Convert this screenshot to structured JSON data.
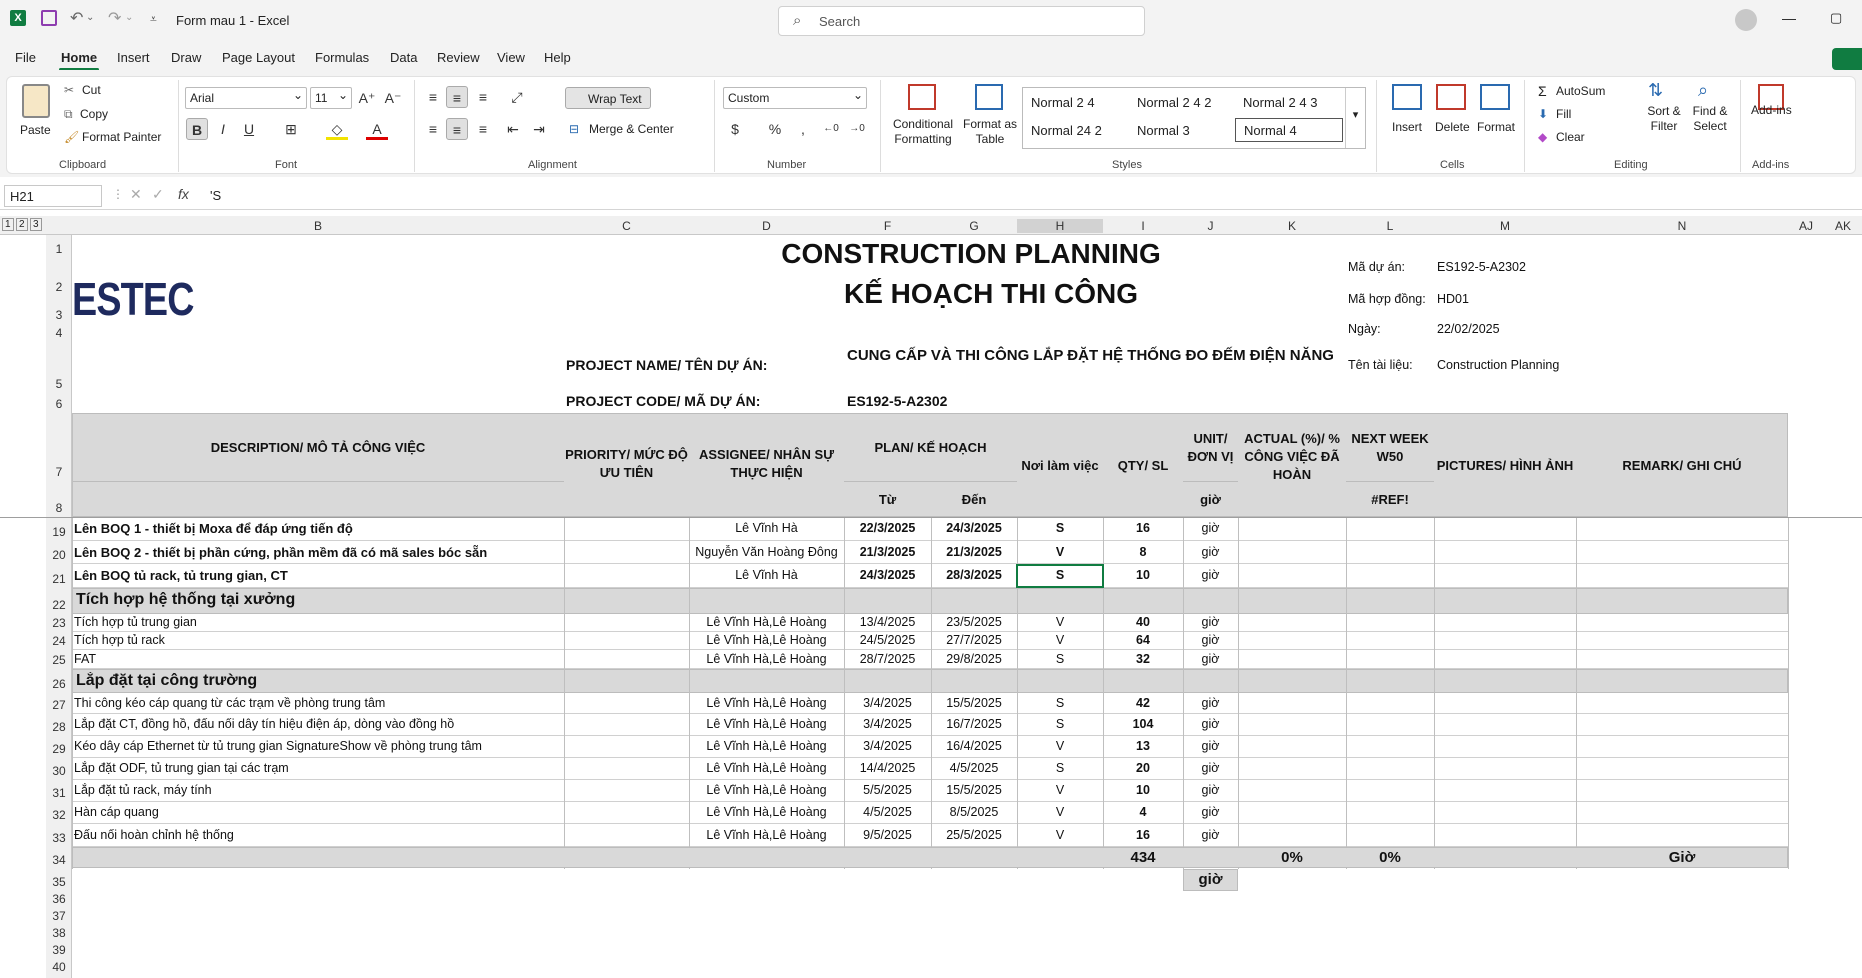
{
  "app": {
    "file_title": "Form mau 1  -  Excel",
    "search_placeholder": "Search"
  },
  "menu": [
    "File",
    "Home",
    "Insert",
    "Draw",
    "Page Layout",
    "Formulas",
    "Data",
    "Review",
    "View",
    "Help"
  ],
  "ribbon": {
    "clipboard": {
      "paste": "Paste",
      "cut": "Cut",
      "copy": "Copy",
      "format_painter": "Format Painter",
      "label": "Clipboard"
    },
    "font": {
      "name": "Arial",
      "size": "11",
      "label": "Font"
    },
    "alignment": {
      "wrap": "Wrap Text",
      "merge": "Merge & Center",
      "label": "Alignment"
    },
    "number": {
      "format": "Custom",
      "label": "Number"
    },
    "styles": {
      "cond": "Conditional Formatting",
      "table": "Format as Table",
      "items": [
        "Normal 2 4",
        "Normal 2 4 2",
        "Normal 2 4 3",
        "Normal 24 2",
        "Normal 3",
        "Normal 4"
      ],
      "label": "Styles"
    },
    "cells": {
      "insert": "Insert",
      "delete": "Delete",
      "format": "Format",
      "label": "Cells"
    },
    "editing": {
      "autosum": "AutoSum",
      "fill": "Fill",
      "clear": "Clear",
      "sort": "Sort & Filter",
      "find": "Find & Select",
      "label": "Editing"
    },
    "addins": {
      "btn": "Add-ins",
      "label": "Add-ins"
    }
  },
  "formula_bar": {
    "cell_ref": "H21",
    "content": "'S"
  },
  "columns": [
    "B",
    "C",
    "D",
    "F",
    "G",
    "H",
    "I",
    "J",
    "K",
    "L",
    "M",
    "N",
    "AJ",
    "AK"
  ],
  "sheet": {
    "logo": "ESTEC",
    "title1": "CONSTRUCTION PLANNING",
    "title2": "KẾ HOẠCH THI CÔNG",
    "info": [
      {
        "label": "Mã dự án:",
        "value": "ES192-5-A2302"
      },
      {
        "label": "Mã hợp đồng:",
        "value": "HD01"
      },
      {
        "label": "Ngày:",
        "value": "22/02/2025"
      },
      {
        "label": "Tên tài liệu:",
        "value": "Construction Planning"
      }
    ],
    "project_name_label": "PROJECT NAME/ TÊN DỰ ÁN:",
    "project_name": "CUNG CẤP VÀ THI CÔNG LẮP ĐẶT HỆ THỐNG ĐO ĐẾM ĐIỆN NĂNG",
    "project_code_label": "PROJECT CODE/ MÃ DỰ ÁN:",
    "project_code": "ES192-5-A2302",
    "headers": {
      "desc": "DESCRIPTION/ MÔ TẢ CÔNG VIỆC",
      "priority": "PRIORITY/ MỨC ĐỘ ƯU TIÊN",
      "assignee": "ASSIGNEE/ NHÂN SỰ THỰC HIỆN",
      "plan": "PLAN/ KẾ HOẠCH",
      "from": "Từ",
      "to": "Đến",
      "place": "Nơi làm việc",
      "qty": "QTY/ SL",
      "unit": "UNIT/ ĐƠN VỊ",
      "unit_sub": "giờ",
      "actual": "ACTUAL (%)/ % CÔNG VIỆC ĐÃ HOÀN",
      "nextweek": "NEXT WEEK W50",
      "ref": "#REF!",
      "pictures": "PICTURES/ HÌNH ẢNH",
      "remark": "REMARK/ GHI CHÚ"
    },
    "rows": [
      {
        "n": "19",
        "desc": "Lên BOQ 1 - thiết bị Moxa để đáp ứng tiến độ",
        "who": "Lê Vĩnh Hà",
        "from": "22/3/2025",
        "to": "24/3/2025",
        "place": "S",
        "qty": "16",
        "unit": "giờ",
        "bold": true
      },
      {
        "n": "20",
        "desc": "Lên BOQ 2 - thiết bị phần cứng, phần mềm đã có mã sales bóc sẵn",
        "who": "Nguyễn Văn Hoàng Đông",
        "from": "21/3/2025",
        "to": "21/3/2025",
        "place": "V",
        "qty": "8",
        "unit": "giờ",
        "bold": true
      },
      {
        "n": "21",
        "desc": "Lên BOQ tủ rack, tủ trung gian, CT",
        "who": "Lê Vĩnh Hà",
        "from": "24/3/2025",
        "to": "28/3/2025",
        "place": "S",
        "qty": "10",
        "unit": "giờ",
        "bold": true
      },
      {
        "n": "22",
        "section": "Tích hợp hệ thống tại xưởng"
      },
      {
        "n": "23",
        "desc": "Tích hợp tủ trung gian",
        "who": "Lê Vĩnh Hà,Lê Hoàng",
        "from": "13/4/2025",
        "to": "23/5/2025",
        "place": "V",
        "qty": "40",
        "unit": "giờ"
      },
      {
        "n": "24",
        "desc": "Tích hợp tủ rack",
        "who": "Lê Vĩnh Hà,Lê Hoàng",
        "from": "24/5/2025",
        "to": "27/7/2025",
        "place": "V",
        "qty": "64",
        "unit": "giờ"
      },
      {
        "n": "25",
        "desc": "FAT",
        "who": "Lê Vĩnh Hà,Lê Hoàng",
        "from": "28/7/2025",
        "to": "29/8/2025",
        "place": "S",
        "qty": "32",
        "unit": "giờ"
      },
      {
        "n": "26",
        "section": "Lắp đặt tại công trường"
      },
      {
        "n": "27",
        "desc": "Thi công kéo cáp quang từ các trạm về phòng trung tâm",
        "who": "Lê Vĩnh Hà,Lê Hoàng",
        "from": "3/4/2025",
        "to": "15/5/2025",
        "place": "S",
        "qty": "42",
        "unit": "giờ"
      },
      {
        "n": "28",
        "desc": "Lắp đặt CT, đồng hồ, đấu nối dây tín hiệu điện áp, dòng vào đồng hồ",
        "who": "Lê Vĩnh Hà,Lê Hoàng",
        "from": "3/4/2025",
        "to": "16/7/2025",
        "place": "S",
        "qty": "104",
        "unit": "giờ"
      },
      {
        "n": "29",
        "desc": "Kéo dây cáp Ethernet từ tủ trung gian SignatureShow về phòng trung tâm",
        "who": "Lê Vĩnh Hà,Lê Hoàng",
        "from": "3/4/2025",
        "to": "16/4/2025",
        "place": "V",
        "qty": "13",
        "unit": "giờ"
      },
      {
        "n": "30",
        "desc": "Lắp đặt ODF, tủ trung gian tại các trạm",
        "who": "Lê Vĩnh Hà,Lê Hoàng",
        "from": "14/4/2025",
        "to": "4/5/2025",
        "place": "S",
        "qty": "20",
        "unit": "giờ"
      },
      {
        "n": "31",
        "desc": "Lắp đặt tủ rack, máy tính",
        "who": "Lê Vĩnh Hà,Lê Hoàng",
        "from": "5/5/2025",
        "to": "15/5/2025",
        "place": "V",
        "qty": "10",
        "unit": "giờ"
      },
      {
        "n": "32",
        "desc": "Hàn cáp quang",
        "who": "Lê Vĩnh Hà,Lê Hoàng",
        "from": "4/5/2025",
        "to": "8/5/2025",
        "place": "V",
        "qty": "4",
        "unit": "giờ"
      },
      {
        "n": "33",
        "desc": "Đấu nối hoàn chỉnh hệ thống",
        "who": "Lê Vĩnh Hà,Lê Hoàng",
        "from": "9/5/2025",
        "to": "25/5/2025",
        "place": "V",
        "qty": "16",
        "unit": "giờ"
      }
    ],
    "totals": {
      "qty": "434",
      "actual": "0%",
      "next": "0%",
      "remark": "Giờ",
      "unit35": "giờ"
    }
  }
}
